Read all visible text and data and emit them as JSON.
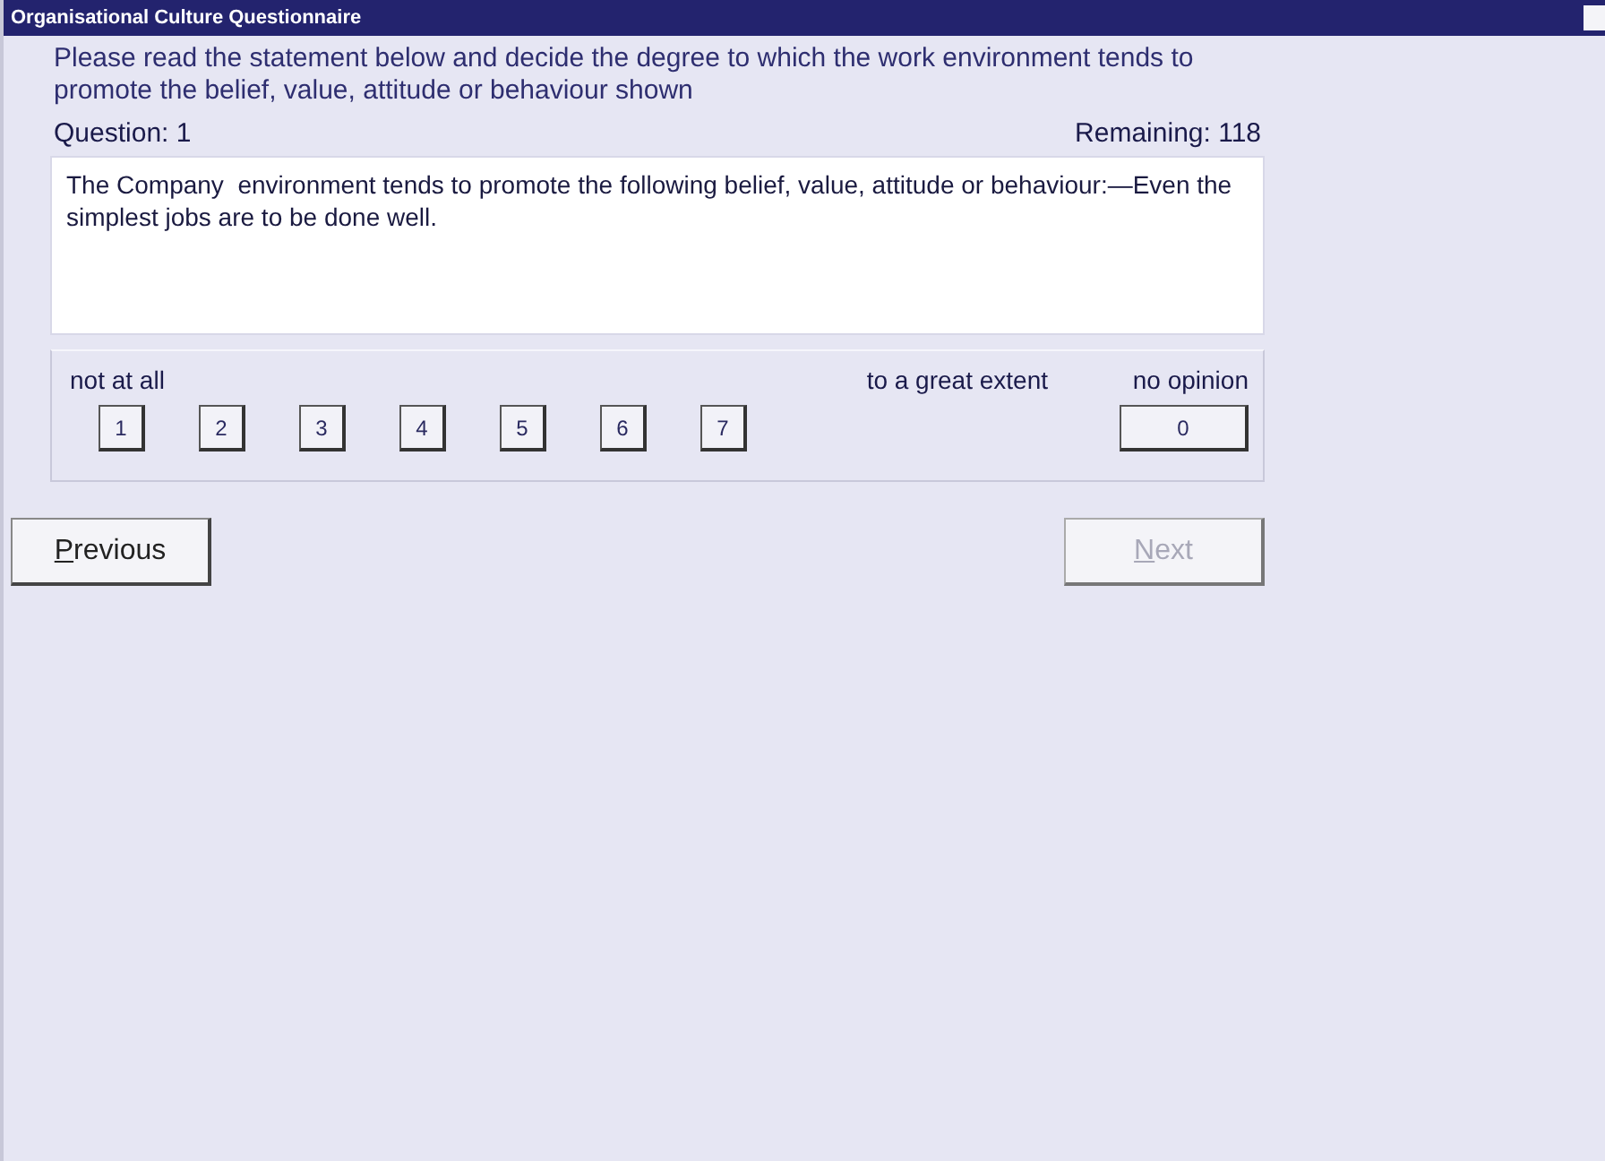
{
  "window": {
    "title": "Organisational Culture Questionnaire"
  },
  "instructions": "Please read the statement below and decide the degree to which the work environment tends to promote the belief, value, attitude or behaviour shown",
  "question_label": "Question: 1",
  "remaining_label": "Remaining: 118",
  "statement": "The Company  environment tends to promote the following belief, value, attitude or behaviour:—Even the simplest jobs are to be done well.",
  "scale": {
    "low_label": "not at all",
    "high_label": "to a great extent",
    "none_label": "no opinion",
    "options": [
      {
        "label": "1"
      },
      {
        "label": "2"
      },
      {
        "label": "3"
      },
      {
        "label": "4"
      },
      {
        "label": "5"
      },
      {
        "label": "6"
      },
      {
        "label": "7"
      }
    ],
    "none_option": {
      "label": "0"
    }
  },
  "buttons": [
    {
      "label": "Previous",
      "disabled": false
    },
    {
      "label": "Next",
      "disabled": true
    }
  ]
}
